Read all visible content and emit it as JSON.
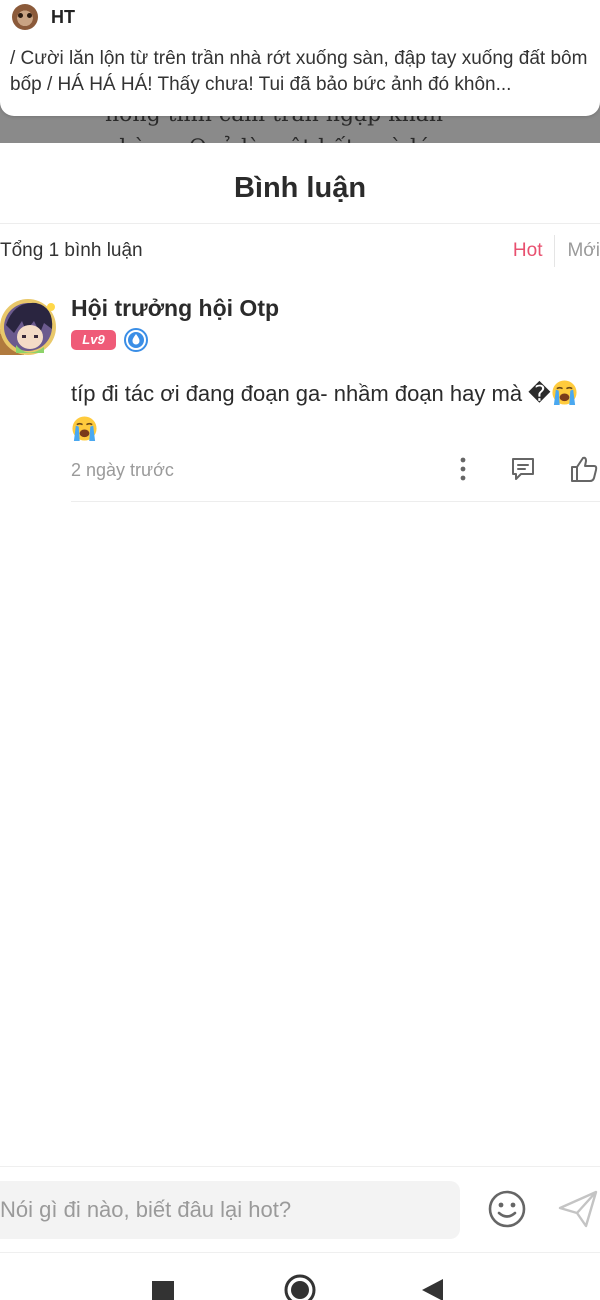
{
  "background_reader": {
    "text_line_1": "nơng tình cảm tràn ngập khắn",
    "text_line_2": "phòng. Quả là một bất ngờ lớn"
  },
  "notification": {
    "sender": "HT",
    "message": "/ Cười lăn lộn từ trên trần nhà rớt xuống sàn, đập tay xuống đất bôm bốp / HÁ HÁ HÁ! Thấy chưa! Tui đã bảo bức ảnh đó khôn..."
  },
  "comments_sheet": {
    "title": "Bình luận",
    "total_label": "Tổng 1 bình luận",
    "sort_tabs": [
      {
        "label": "Hot",
        "active": true
      },
      {
        "label": "Mới",
        "active": false
      }
    ]
  },
  "comments": [
    {
      "author": "Hội trưởng hội Otp",
      "level_badge": "Lv9",
      "verified_icon": "droplet-verified-icon",
      "text": "típ đi tác ơi đang đoạn ga- nhầm đoạn hay mà ",
      "text_glyph": "�",
      "emojis": [
        "loudly-crying-face",
        "loudly-crying-face"
      ],
      "time": "2 ngày trước",
      "actions": [
        "more-vertical-icon",
        "reply-comment-icon",
        "like-thumb-icon"
      ]
    }
  ],
  "comment_input": {
    "placeholder": "Nói gì đi nào, biết đâu lại hot?",
    "value": "",
    "emoji_icon": "smiley-face-icon",
    "send_icon": "paper-plane-send-icon"
  },
  "system_nav": {
    "buttons": [
      "recent-apps-square-icon",
      "home-circle-icon",
      "back-triangle-icon"
    ]
  },
  "colors": {
    "accent": "#e8506f",
    "level_badge": "#ef5b78",
    "verified": "#3a8ee6",
    "muted_text": "#9a9a9a"
  }
}
